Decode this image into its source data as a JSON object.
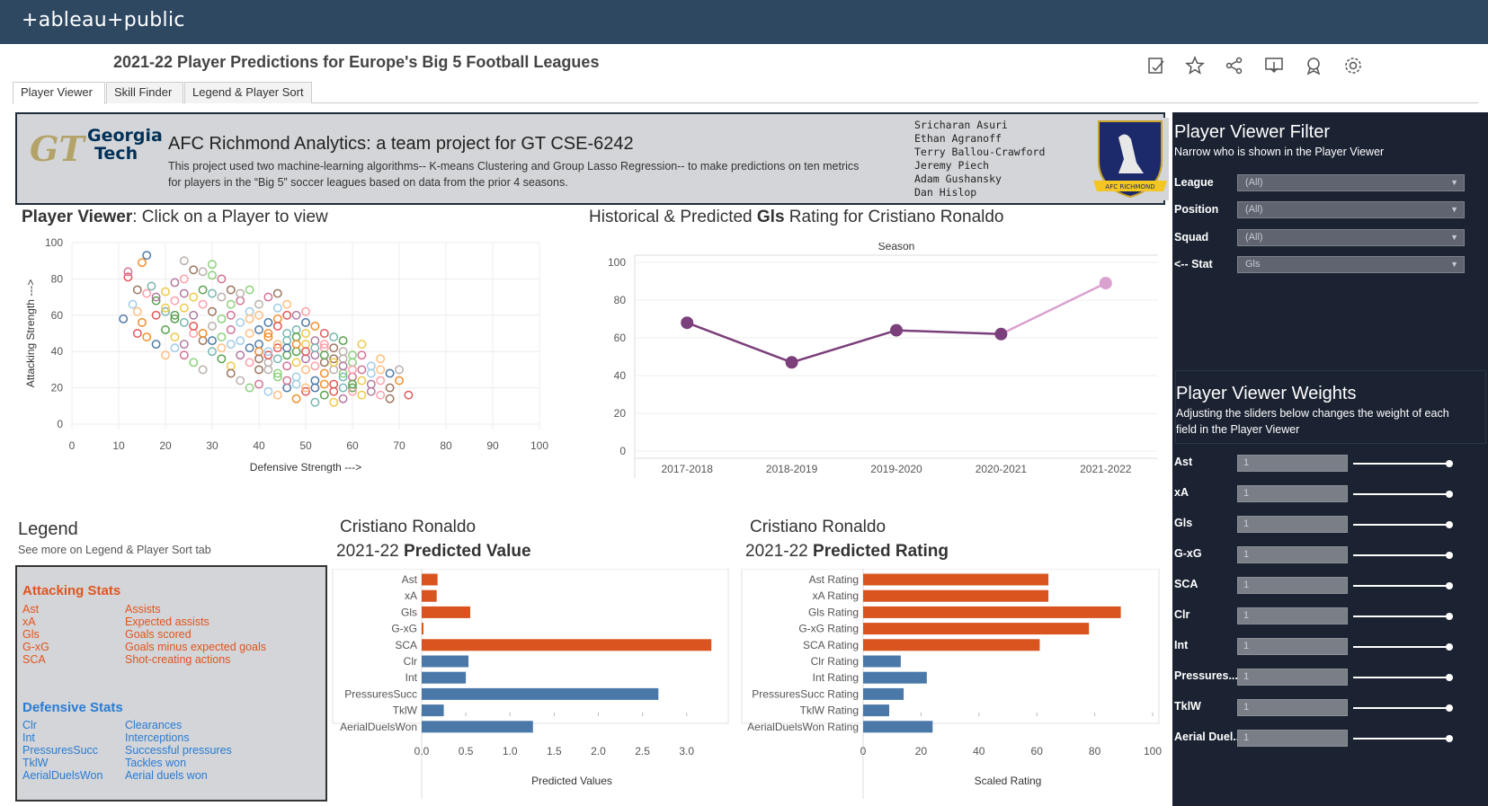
{
  "app": {
    "logo": "+ableau+public",
    "title": "2021-22 Player Predictions for Europe's Big 5 Football Leagues",
    "tabs": [
      {
        "label": "Player Viewer",
        "active": true
      },
      {
        "label": "Skill Finder",
        "active": false
      },
      {
        "label": "Legend & Player Sort",
        "active": false
      }
    ],
    "toolbar_icons": [
      "edit-icon",
      "star-icon",
      "share-icon",
      "download-icon",
      "badge-icon",
      "settings-icon"
    ]
  },
  "banner": {
    "logo_text_1": "Georgia",
    "logo_text_2": "Tech",
    "title": "AFC Richmond Analytics: a team project for GT CSE-6242",
    "description": "This project used two machine-learning algorithms-- K-means Clustering and Group Lasso Regression-- to make predictions on ten metrics for players in the “Big 5” soccer leagues based on data from the prior 4 seasons.",
    "authors": [
      "Sricharan Asuri",
      "Ethan Agranoff",
      "Terry Ballou-Crawford",
      "Jeremy Piech",
      "Adam Gushansky",
      "Dan Hislop"
    ],
    "crest_text": "AFC RICHMOND"
  },
  "filter_panel": {
    "title": "Player Viewer Filter",
    "subtitle": "Narrow who is shown in the Player Viewer",
    "filters": [
      {
        "label": "League",
        "value": "(All)"
      },
      {
        "label": "Position",
        "value": "(All)"
      },
      {
        "label": "Squad",
        "value": "(All)"
      },
      {
        "label": "<-- Stat",
        "value": "Gls"
      }
    ]
  },
  "weights_panel": {
    "title": "Player Viewer Weights",
    "subtitle": "Adjusting the sliders below changes the weight of each field in the Player Viewer",
    "weights": [
      {
        "label": "Ast",
        "value": "1",
        "level": 1
      },
      {
        "label": "xA",
        "value": "1",
        "level": 1
      },
      {
        "label": "Gls",
        "value": "1",
        "level": 1
      },
      {
        "label": "G-xG",
        "value": "1",
        "level": 1
      },
      {
        "label": "SCA",
        "value": "1",
        "level": 1
      },
      {
        "label": "Clr",
        "value": "1",
        "level": 1
      },
      {
        "label": "Int",
        "value": "1",
        "level": 1
      },
      {
        "label": "Pressures...",
        "value": "1",
        "level": 1
      },
      {
        "label": "TklW",
        "value": "1",
        "level": 1
      },
      {
        "label": "Aerial Duel...",
        "value": "1",
        "level": 1
      }
    ]
  },
  "player_viewer": {
    "title_bold": "Player Viewer",
    "title_rest": ": Click on a Player to view"
  },
  "history": {
    "title_pre": "Historical & Predicted ",
    "title_bold": "Gls",
    "title_post": " Rating for Cristiano Ronaldo"
  },
  "legend": {
    "title": "Legend",
    "subtitle": "See more on Legend & Player Sort tab",
    "attacking_head": "Attacking Stats",
    "attacking": [
      {
        "k": "Ast",
        "v": "Assists"
      },
      {
        "k": "xA",
        "v": "Expected assists"
      },
      {
        "k": "Gls",
        "v": "Goals scored"
      },
      {
        "k": "G-xG",
        "v": "Goals minus expected goals"
      },
      {
        "k": "SCA",
        "v": "Shot-creating actions"
      }
    ],
    "defensive_head": "Defensive Stats",
    "defensive": [
      {
        "k": "Clr",
        "v": "Clearances"
      },
      {
        "k": "Int",
        "v": "Interceptions"
      },
      {
        "k": "PressuresSucc",
        "v": "Successful pressures"
      },
      {
        "k": "TklW",
        "v": "Tackles won"
      },
      {
        "k": "AerialDuelsWon",
        "v": "Aerial duels won"
      }
    ]
  },
  "pred_value": {
    "line1": "Cristiano Ronaldo",
    "line2_pre": "2021-22 ",
    "line2_bold": "Predicted Value"
  },
  "pred_rating": {
    "line1": "Cristiano Ronaldo",
    "line2_pre": "2021-22 ",
    "line2_bold": "Predicted Rating"
  },
  "colors": {
    "topbar": "#2e4862",
    "attack": "#d9541e",
    "defense": "#4a78a8",
    "line": "#7b3f7b",
    "line_pred": "#d9a1d0",
    "panel": "#1b2332"
  },
  "chart_data": [
    {
      "type": "scatter",
      "xlabel": "Defensive Strength --->",
      "ylabel": "Attacking Strength --->",
      "xlim": [
        0,
        100
      ],
      "ylim": [
        0,
        100
      ],
      "xticks": [
        0,
        10,
        20,
        30,
        40,
        50,
        60,
        70,
        80,
        90,
        100
      ],
      "yticks": [
        0,
        20,
        40,
        60,
        80,
        100
      ],
      "grid": true,
      "note_points": "approximate cloud of several hundred players",
      "points": [
        [
          16,
          93
        ],
        [
          15,
          89
        ],
        [
          12,
          81
        ],
        [
          17,
          76
        ],
        [
          18,
          68
        ],
        [
          20,
          73
        ],
        [
          22,
          78
        ],
        [
          24,
          80
        ],
        [
          26,
          85
        ],
        [
          28,
          84
        ],
        [
          30,
          82
        ],
        [
          32,
          80
        ],
        [
          13,
          66
        ],
        [
          14,
          62
        ],
        [
          11,
          58
        ],
        [
          15,
          56
        ],
        [
          18,
          60
        ],
        [
          20,
          62
        ],
        [
          22,
          58
        ],
        [
          24,
          64
        ],
        [
          26,
          60
        ],
        [
          28,
          66
        ],
        [
          30,
          62
        ],
        [
          32,
          70
        ],
        [
          34,
          66
        ],
        [
          36,
          68
        ],
        [
          38,
          62
        ],
        [
          40,
          60
        ],
        [
          42,
          56
        ],
        [
          44,
          58
        ],
        [
          46,
          60
        ],
        [
          48,
          52
        ],
        [
          20,
          52
        ],
        [
          22,
          48
        ],
        [
          24,
          44
        ],
        [
          26,
          50
        ],
        [
          28,
          46
        ],
        [
          30,
          54
        ],
        [
          32,
          48
        ],
        [
          34,
          52
        ],
        [
          36,
          46
        ],
        [
          38,
          50
        ],
        [
          40,
          44
        ],
        [
          42,
          48
        ],
        [
          44,
          42
        ],
        [
          46,
          46
        ],
        [
          48,
          40
        ],
        [
          50,
          44
        ],
        [
          52,
          38
        ],
        [
          54,
          42
        ],
        [
          56,
          36
        ],
        [
          58,
          40
        ],
        [
          60,
          34
        ],
        [
          62,
          38
        ],
        [
          64,
          32
        ],
        [
          66,
          30
        ],
        [
          68,
          28
        ],
        [
          70,
          24
        ],
        [
          72,
          16
        ],
        [
          30,
          40
        ],
        [
          32,
          36
        ],
        [
          34,
          32
        ],
        [
          36,
          38
        ],
        [
          38,
          34
        ],
        [
          40,
          30
        ],
        [
          42,
          34
        ],
        [
          44,
          28
        ],
        [
          46,
          32
        ],
        [
          48,
          26
        ],
        [
          50,
          30
        ],
        [
          52,
          24
        ],
        [
          54,
          28
        ],
        [
          56,
          22
        ],
        [
          58,
          26
        ],
        [
          60,
          20
        ],
        [
          62,
          24
        ],
        [
          64,
          18
        ],
        [
          66,
          16
        ],
        [
          68,
          14
        ],
        [
          36,
          24
        ],
        [
          38,
          20
        ],
        [
          40,
          22
        ],
        [
          42,
          18
        ],
        [
          44,
          16
        ],
        [
          46,
          20
        ],
        [
          48,
          14
        ],
        [
          50,
          18
        ],
        [
          52,
          12
        ],
        [
          54,
          16
        ],
        [
          56,
          12
        ],
        [
          58,
          14
        ],
        [
          60,
          18
        ],
        [
          34,
          28
        ],
        [
          28,
          30
        ],
        [
          26,
          34
        ],
        [
          24,
          38
        ],
        [
          22,
          42
        ],
        [
          20,
          38
        ],
        [
          18,
          44
        ],
        [
          16,
          48
        ],
        [
          14,
          50
        ],
        [
          30,
          72
        ],
        [
          28,
          74
        ],
        [
          26,
          70
        ],
        [
          24,
          72
        ],
        [
          22,
          68
        ],
        [
          34,
          74
        ],
        [
          36,
          72
        ],
        [
          38,
          74
        ],
        [
          42,
          70
        ],
        [
          44,
          64
        ],
        [
          46,
          66
        ],
        [
          50,
          56
        ],
        [
          52,
          54
        ],
        [
          54,
          50
        ],
        [
          56,
          48
        ],
        [
          58,
          46
        ],
        [
          62,
          44
        ],
        [
          48,
          60
        ],
        [
          50,
          62
        ],
        [
          44,
          72
        ],
        [
          40,
          66
        ],
        [
          32,
          58
        ],
        [
          34,
          60
        ],
        [
          36,
          56
        ],
        [
          38,
          58
        ],
        [
          40,
          52
        ],
        [
          42,
          50
        ],
        [
          44,
          54
        ],
        [
          46,
          50
        ],
        [
          48,
          48
        ],
        [
          50,
          50
        ],
        [
          52,
          46
        ],
        [
          54,
          44
        ],
        [
          56,
          42
        ],
        [
          58,
          36
        ],
        [
          60,
          38
        ],
        [
          62,
          30
        ],
        [
          64,
          28
        ],
        [
          66,
          36
        ],
        [
          38,
          42
        ],
        [
          40,
          40
        ],
        [
          42,
          38
        ],
        [
          44,
          36
        ],
        [
          46,
          38
        ],
        [
          48,
          34
        ],
        [
          50,
          36
        ],
        [
          52,
          32
        ],
        [
          54,
          34
        ],
        [
          56,
          30
        ],
        [
          58,
          28
        ],
        [
          60,
          26
        ],
        [
          34,
          44
        ],
        [
          32,
          42
        ],
        [
          30,
          46
        ],
        [
          28,
          50
        ],
        [
          26,
          54
        ],
        [
          24,
          56
        ],
        [
          22,
          60
        ],
        [
          20,
          64
        ],
        [
          18,
          70
        ],
        [
          16,
          72
        ],
        [
          14,
          74
        ],
        [
          24,
          90
        ],
        [
          30,
          88
        ],
        [
          12,
          84
        ],
        [
          42,
          40
        ],
        [
          44,
          44
        ],
        [
          46,
          42
        ],
        [
          48,
          44
        ],
        [
          50,
          40
        ],
        [
          52,
          42
        ],
        [
          54,
          38
        ],
        [
          56,
          34
        ],
        [
          58,
          32
        ],
        [
          60,
          30
        ],
        [
          40,
          36
        ],
        [
          42,
          30
        ],
        [
          44,
          26
        ],
        [
          46,
          24
        ],
        [
          48,
          22
        ],
        [
          50,
          20
        ],
        [
          52,
          20
        ],
        [
          54,
          22
        ],
        [
          56,
          18
        ],
        [
          58,
          20
        ],
        [
          60,
          22
        ],
        [
          62,
          16
        ],
        [
          64,
          22
        ],
        [
          66,
          24
        ],
        [
          68,
          20
        ],
        [
          70,
          30
        ]
      ]
    },
    {
      "type": "line",
      "title": "Season",
      "categories": [
        "2017-2018",
        "2018-2019",
        "2019-2020",
        "2020-2021",
        "2021-2022"
      ],
      "values": [
        68,
        47,
        64,
        62,
        89
      ],
      "predicted_index": 4,
      "ylim": [
        0,
        100
      ],
      "yticks": [
        0,
        20,
        40,
        60,
        80,
        100
      ],
      "grid": true
    },
    {
      "type": "bar",
      "orientation": "horizontal",
      "categories": [
        "Ast",
        "xA",
        "Gls",
        "G-xG",
        "SCA",
        "Clr",
        "Int",
        "PressuresSucc",
        "TklW",
        "AerialDuelsWon"
      ],
      "values": [
        0.18,
        0.17,
        0.55,
        0.02,
        3.28,
        0.53,
        0.5,
        2.68,
        0.25,
        1.26
      ],
      "groups": [
        "attack",
        "attack",
        "attack",
        "attack",
        "attack",
        "defense",
        "defense",
        "defense",
        "defense",
        "defense"
      ],
      "xlabel": "Predicted Values",
      "xlim": [
        0,
        3.4
      ],
      "xticks": [
        "0.0",
        "0.5",
        "1.0",
        "1.5",
        "2.0",
        "2.5",
        "3.0"
      ]
    },
    {
      "type": "bar",
      "orientation": "horizontal",
      "categories": [
        "Ast Rating",
        "xA Rating",
        "Gls Rating",
        "G-xG Rating",
        "SCA Rating",
        "Clr Rating",
        "Int Rating",
        "PressuresSucc Rating",
        "TklW Rating",
        "AerialDuelsWon Rating"
      ],
      "values": [
        64,
        64,
        89,
        78,
        61,
        13,
        22,
        14,
        9,
        24
      ],
      "groups": [
        "attack",
        "attack",
        "attack",
        "attack",
        "attack",
        "defense",
        "defense",
        "defense",
        "defense",
        "defense"
      ],
      "xlabel": "Scaled Rating",
      "xlim": [
        0,
        100
      ],
      "xticks": [
        "0",
        "20",
        "40",
        "60",
        "80",
        "100"
      ]
    }
  ]
}
